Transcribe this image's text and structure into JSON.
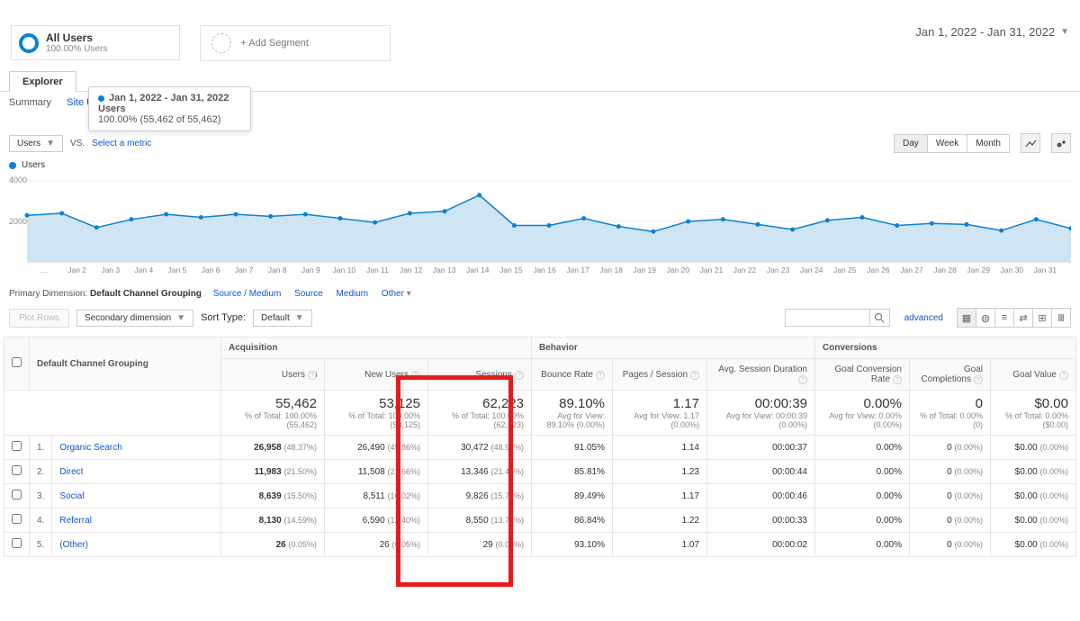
{
  "segments": {
    "all_users_title": "All Users",
    "all_users_sub": "100.00% Users",
    "add_segment": "+ Add Segment"
  },
  "date_range": "Jan 1, 2022 - Jan 31, 2022",
  "tabs": {
    "explorer": "Explorer",
    "summary": "Summary",
    "site_usage": "Site Usage"
  },
  "tooltip": {
    "title": "Jan 1, 2022 - Jan 31, 2022",
    "line1": "Users",
    "line2": "100.00% (55,462 of 55,462)"
  },
  "metric_selector": {
    "primary": "Users",
    "vs": "VS.",
    "select": "Select a metric"
  },
  "granularity": {
    "day": "Day",
    "week": "Week",
    "month": "Month"
  },
  "legend": "Users",
  "chart_data": {
    "type": "area",
    "xlabel": "",
    "ylabel": "",
    "ylim": [
      0,
      4000
    ],
    "yticks": [
      2000,
      4000
    ],
    "categories": [
      "…",
      "Jan 2",
      "Jan 3",
      "Jan 4",
      "Jan 5",
      "Jan 6",
      "Jan 7",
      "Jan 8",
      "Jan 9",
      "Jan 10",
      "Jan 11",
      "Jan 12",
      "Jan 13",
      "Jan 14",
      "Jan 15",
      "Jan 16",
      "Jan 17",
      "Jan 18",
      "Jan 19",
      "Jan 20",
      "Jan 21",
      "Jan 22",
      "Jan 23",
      "Jan 24",
      "Jan 25",
      "Jan 26",
      "Jan 27",
      "Jan 28",
      "Jan 29",
      "Jan 30",
      "Jan 31"
    ],
    "values": [
      2300,
      2400,
      1700,
      2100,
      2350,
      2200,
      2350,
      2250,
      2350,
      2150,
      1950,
      2400,
      2500,
      3300,
      1800,
      1800,
      2150,
      1750,
      1500,
      2000,
      2100,
      1850,
      1600,
      2050,
      2200,
      1800,
      1900,
      1850,
      1550,
      2100,
      1650
    ]
  },
  "primary_dimension": {
    "label": "Primary Dimension:",
    "active": "Default Channel Grouping",
    "options": [
      "Source / Medium",
      "Source",
      "Medium",
      "Other"
    ]
  },
  "filter_row": {
    "plot_rows": "Plot Rows",
    "secondary": "Secondary dimension",
    "sort_type": "Sort Type:",
    "sort_default": "Default",
    "advanced": "advanced"
  },
  "table": {
    "groups": {
      "acq": "Acquisition",
      "beh": "Behavior",
      "conv": "Conversions"
    },
    "dim_header": "Default Channel Grouping",
    "cols": {
      "users": "Users",
      "new_users": "New Users",
      "sessions": "Sessions",
      "bounce": "Bounce Rate",
      "pps": "Pages / Session",
      "asd": "Avg. Session Duration",
      "gcr": "Goal Conversion Rate",
      "gc": "Goal Completions",
      "gv": "Goal Value"
    },
    "totals": {
      "users": "55,462",
      "users_sub": "% of Total: 100.00% (55,462)",
      "new_users": "53,125",
      "new_users_sub": "% of Total: 100.00% (53,125)",
      "sessions": "62,223",
      "sessions_sub": "% of Total: 100.00% (62,223)",
      "bounce": "89.10%",
      "bounce_sub": "Avg for View: 89.10% (0.00%)",
      "pps": "1.17",
      "pps_sub": "Avg for View: 1.17 (0.00%)",
      "asd": "00:00:39",
      "asd_sub": "Avg for View: 00:00:39 (0.00%)",
      "gcr": "0.00%",
      "gcr_sub": "Avg for View: 0.00% (0.00%)",
      "gc": "0",
      "gc_sub": "% of Total: 0.00% (0)",
      "gv": "$0.00",
      "gv_sub": "% of Total: 0.00% ($0.00)"
    },
    "rows": [
      {
        "n": "1.",
        "name": "Organic Search",
        "users": "26,958",
        "users_pct": "(48.37%)",
        "new": "26,490",
        "new_pct": "(49.86%)",
        "sess": "30,472",
        "sess_pct": "(48.97%)",
        "br": "91.05%",
        "pps": "1.14",
        "asd": "00:00:37",
        "gcr": "0.00%",
        "gc": "0",
        "gc_pct": "(0.00%)",
        "gv": "$0.00",
        "gv_pct": "(0.00%)"
      },
      {
        "n": "2.",
        "name": "Direct",
        "users": "11,983",
        "users_pct": "(21.50%)",
        "new": "11,508",
        "new_pct": "(21.66%)",
        "sess": "13,346",
        "sess_pct": "(21.45%)",
        "br": "85.81%",
        "pps": "1.23",
        "asd": "00:00:44",
        "gcr": "0.00%",
        "gc": "0",
        "gc_pct": "(0.00%)",
        "gv": "$0.00",
        "gv_pct": "(0.00%)"
      },
      {
        "n": "3.",
        "name": "Social",
        "users": "8,639",
        "users_pct": "(15.50%)",
        "new": "8,511",
        "new_pct": "(16.02%)",
        "sess": "9,826",
        "sess_pct": "(15.79%)",
        "br": "89.49%",
        "pps": "1.17",
        "asd": "00:00:46",
        "gcr": "0.00%",
        "gc": "0",
        "gc_pct": "(0.00%)",
        "gv": "$0.00",
        "gv_pct": "(0.00%)"
      },
      {
        "n": "4.",
        "name": "Referral",
        "users": "8,130",
        "users_pct": "(14.59%)",
        "new": "6,590",
        "new_pct": "(12.40%)",
        "sess": "8,550",
        "sess_pct": "(13.74%)",
        "br": "86.84%",
        "pps": "1.22",
        "asd": "00:00:33",
        "gcr": "0.00%",
        "gc": "0",
        "gc_pct": "(0.00%)",
        "gv": "$0.00",
        "gv_pct": "(0.00%)"
      },
      {
        "n": "5.",
        "name": "(Other)",
        "users": "26",
        "users_pct": "(0.05%)",
        "new": "26",
        "new_pct": "(0.05%)",
        "sess": "29",
        "sess_pct": "(0.05%)",
        "br": "93.10%",
        "pps": "1.07",
        "asd": "00:00:02",
        "gcr": "0.00%",
        "gc": "0",
        "gc_pct": "(0.00%)",
        "gv": "$0.00",
        "gv_pct": "(0.00%)"
      }
    ]
  }
}
